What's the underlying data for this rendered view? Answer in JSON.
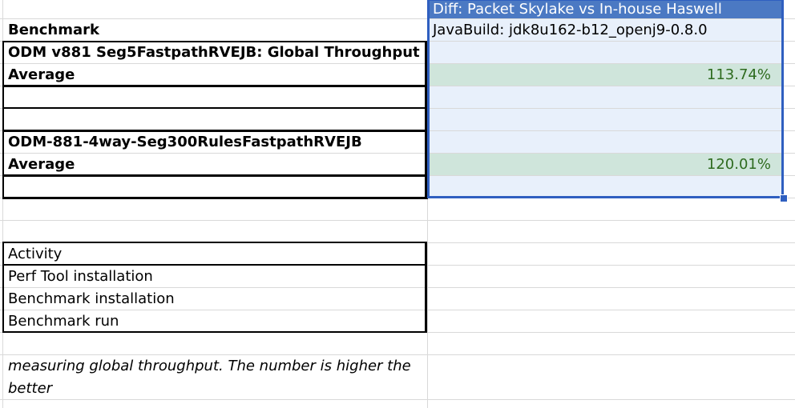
{
  "header": {
    "column_title": "Diff: Packet Skylake vs In-house Haswell"
  },
  "rows": {
    "benchmark_label": "Benchmark",
    "javabuild": "JavaBuild: jdk8u162-b12_openj9-0.8.0",
    "test1_name": "ODM v881 Seg5FastpathRVEJB: Global Throughput",
    "test1_avg_label": "Average",
    "test1_avg_value": "113.74%",
    "test2_name": "ODM-881-4way-Seg300RulesFastpathRVEJB",
    "test2_avg_label": "Average",
    "test2_avg_value": "120.01%"
  },
  "activity": {
    "header": "Activity",
    "items": [
      "Perf Tool installation",
      "Benchmark installation",
      "Benchmark run"
    ]
  },
  "note": "measuring global throughput. The number is higher the better",
  "colors": {
    "selection": "#2f5fc0",
    "header_fill": "#4b79c3",
    "value_fill": "#cfe5db",
    "value_text": "#2e6b1f",
    "column_fill": "#e8f0fb"
  }
}
